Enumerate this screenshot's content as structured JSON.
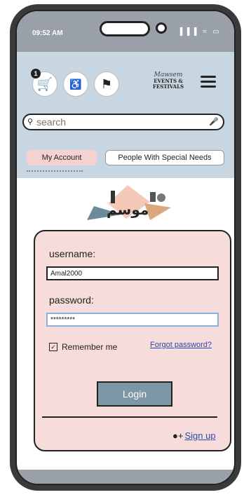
{
  "status_bar": {
    "time": "09:52 AM",
    "icons": "▐▐▐ ≈ ▭"
  },
  "header": {
    "cart_badge": "1",
    "cart_icon": "🛒",
    "accessibility_icon": "♿",
    "flag_icon": "⚑",
    "logo_title": "Mawsem",
    "logo_subtitle": "EVENTS & FESTIVALS",
    "menu_icon": "hamburger-icon"
  },
  "search": {
    "placeholder": "search",
    "icon": "⚲",
    "mic_icon": "🎤"
  },
  "tabs": [
    {
      "label": "My Account"
    },
    {
      "label": "People With Special Needs"
    }
  ],
  "brand": {
    "label": "موسم"
  },
  "login": {
    "username_label": "username:",
    "username_value": "Amal2000",
    "password_label": "password:",
    "password_value": "*********",
    "remember_label": "Remember me",
    "remember_checked": "✓",
    "forgot_label": "Forgot password?",
    "login_button": "Login",
    "signup_icon": "●+",
    "signup_label": "Sign up"
  },
  "colors": {
    "header_bg": "#c7d6e0",
    "card_bg": "#f7dcdc",
    "button_bg": "#7d97a6",
    "link": "#2b4aa8",
    "tab_active": "#f5d2d0"
  }
}
